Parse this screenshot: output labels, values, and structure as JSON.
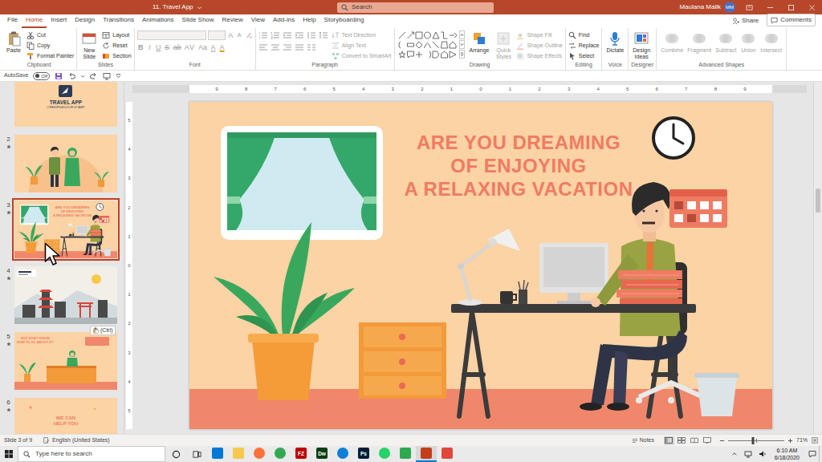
{
  "window": {
    "title": "11. Travel App"
  },
  "search": {
    "placeholder": "Search"
  },
  "account": {
    "name": "Maulana Malik",
    "initials": "MM"
  },
  "tabs": [
    {
      "label": "File",
      "selected": false
    },
    {
      "label": "Home",
      "selected": true
    },
    {
      "label": "Insert",
      "selected": false
    },
    {
      "label": "Design",
      "selected": false
    },
    {
      "label": "Transitions",
      "selected": false
    },
    {
      "label": "Animations",
      "selected": false
    },
    {
      "label": "Slide Show",
      "selected": false
    },
    {
      "label": "Review",
      "selected": false
    },
    {
      "label": "View",
      "selected": false
    },
    {
      "label": "Add-ins",
      "selected": false
    },
    {
      "label": "Help",
      "selected": false
    },
    {
      "label": "Storyboarding",
      "selected": false
    }
  ],
  "share": "Share",
  "comments": "Comments",
  "ribbon": {
    "groups": [
      {
        "label": "Clipboard",
        "columns": [
          {
            "kind": "large",
            "buttons": [
              {
                "label": "Paste",
                "disabled": false
              }
            ]
          },
          {
            "kind": "stack",
            "buttons": [
              {
                "label": "Cut",
                "disabled": false
              },
              {
                "label": "Copy",
                "disabled": false
              },
              {
                "label": "Format Painter",
                "disabled": false
              }
            ]
          }
        ]
      },
      {
        "label": "Slides",
        "columns": [
          {
            "kind": "large",
            "buttons": [
              {
                "label": "New Slide",
                "disabled": false
              }
            ]
          },
          {
            "kind": "stack",
            "buttons": [
              {
                "label": "Layout",
                "disabled": false
              },
              {
                "label": "Reset",
                "disabled": false
              },
              {
                "label": "Section",
                "disabled": false
              }
            ]
          }
        ]
      },
      {
        "label": "Font",
        "columns": [
          {
            "kind": "font",
            "rows": [
              [
                {
                  "label": "A",
                  "disabled": true
                },
                {
                  "label": "A",
                  "disabled": true
                }
              ],
              [
                {
                  "label": "B",
                  "disabled": true
                },
                {
                  "label": "I",
                  "disabled": true
                },
                {
                  "label": "U",
                  "disabled": true
                },
                {
                  "label": "S",
                  "disabled": true
                },
                {
                  "label": "ab",
                  "disabled": true
                },
                {
                  "label": "AV",
                  "disabled": true
                },
                {
                  "label": "Aa",
                  "disabled": true
                },
                {
                  "label": "A",
                  "disabled": true
                },
                {
                  "label": "A",
                  "disabled": true
                }
              ]
            ]
          }
        ]
      },
      {
        "label": "Paragraph",
        "columns": [
          {
            "kind": "paragraph"
          },
          {
            "kind": "stack",
            "buttons": [
              {
                "label": "Text Direction",
                "disabled": true
              },
              {
                "label": "Align Text",
                "disabled": true
              },
              {
                "label": "Convert to SmartArt",
                "disabled": true
              }
            ]
          }
        ]
      },
      {
        "label": "Drawing",
        "columns": [
          {
            "kind": "shapes"
          },
          {
            "kind": "large",
            "buttons": [
              {
                "label": "Arrange",
                "disabled": false
              }
            ]
          },
          {
            "kind": "large",
            "buttons": [
              {
                "label": "Quick Styles",
                "disabled": true
              }
            ]
          },
          {
            "kind": "stack",
            "buttons": [
              {
                "label": "Shape Fill",
                "disabled": true
              },
              {
                "label": "Shape Outline",
                "disabled": true
              },
              {
                "label": "Shape Effects",
                "disabled": true
              }
            ]
          }
        ]
      },
      {
        "label": "Editing",
        "columns": [
          {
            "kind": "stack",
            "buttons": [
              {
                "label": "Find",
                "disabled": false
              },
              {
                "label": "Replace",
                "disabled": false
              },
              {
                "label": "Select",
                "disabled": false
              }
            ]
          }
        ]
      },
      {
        "label": "Voice",
        "columns": [
          {
            "kind": "large",
            "buttons": [
              {
                "label": "Dictate",
                "disabled": false
              }
            ]
          }
        ]
      },
      {
        "label": "Designer",
        "columns": [
          {
            "kind": "large",
            "buttons": [
              {
                "label": "Design Ideas",
                "disabled": false
              }
            ]
          }
        ]
      },
      {
        "label": "Advanced Shapes",
        "columns": [
          {
            "kind": "large",
            "buttons": [
              {
                "label": "Combine",
                "disabled": true
              },
              {
                "label": "Fragment",
                "disabled": true
              },
              {
                "label": "Subtract",
                "disabled": true
              },
              {
                "label": "Union",
                "disabled": true
              },
              {
                "label": "Intersect",
                "disabled": true
              }
            ]
          }
        ]
      }
    ]
  },
  "quick_access": {
    "autosave_label": "AutoSave",
    "autosave_state": "Off",
    "autosave_on": false
  },
  "thumbnails": [
    {
      "selected": false,
      "lines": [
        "TRAVEL APP",
        "LOREM IPSUM DOLOR SIT AMET"
      ]
    },
    {
      "number": "2",
      "selected": false,
      "lines": []
    },
    {
      "number": "3",
      "selected": true,
      "lines": [
        "ARE YOU DREAMING",
        "OF ENJOYING",
        "A RELAXING VACATION"
      ]
    },
    {
      "number": "4",
      "selected": false,
      "lines": []
    },
    {
      "number": "5",
      "selected": false,
      "lines": [
        "BUT DON'T KNOW",
        "HOW TO GO ABOUT IT?"
      ]
    },
    {
      "number": "6",
      "selected": false,
      "lines": [
        "WE CAN",
        "HELP YOU"
      ]
    }
  ],
  "paste_options": {
    "label": "(Ctrl)"
  },
  "ruler": {
    "horizontal": [
      "9",
      "8",
      "7",
      "6",
      "5",
      "4",
      "3",
      "2",
      "1",
      "0",
      "1",
      "2",
      "3",
      "4",
      "5",
      "6",
      "7",
      "8",
      "9"
    ],
    "vertical": [
      "5",
      "4",
      "3",
      "2",
      "1",
      "0",
      "1",
      "2",
      "3",
      "4",
      "5"
    ]
  },
  "slide": {
    "title_lines": [
      "ARE YOU DREAMING",
      "OF ENJOYING",
      "A RELAXING VACATION"
    ]
  },
  "status_bar": {
    "slide": "Slide 3 of 9",
    "language": "English (United States)",
    "notes": "Notes",
    "zoom": {
      "level": 0.45,
      "reading": "71%"
    }
  },
  "taskbar": {
    "search_placeholder": "Type here to search",
    "apps": [
      {
        "kind": "square",
        "color": "#0078d7",
        "active": false
      },
      {
        "kind": "square",
        "color": "#f8c94a",
        "active": false
      },
      {
        "kind": "circle",
        "color": "#ff7139",
        "active": false
      },
      {
        "kind": "circle",
        "color": "#34a853",
        "active": false
      },
      {
        "kind": "square",
        "color": "#bf0000",
        "glyph": "FZ",
        "active": false
      },
      {
        "kind": "square",
        "color": "#0a3d12",
        "glyph": "Dw",
        "active": false
      },
      {
        "kind": "circle",
        "color": "#0c7fd8",
        "active": false
      },
      {
        "kind": "square",
        "color": "#001e36",
        "glyph": "Ps",
        "active": false
      },
      {
        "kind": "circle",
        "color": "#25d366",
        "active": false
      },
      {
        "kind": "square",
        "color": "#2fa84f",
        "active": false
      },
      {
        "kind": "square",
        "color": "#c43e1c",
        "active": true
      },
      {
        "kind": "square",
        "color": "#e0483b",
        "active": false
      }
    ],
    "time": "6:10 AM",
    "date": "6/18/2020"
  }
}
